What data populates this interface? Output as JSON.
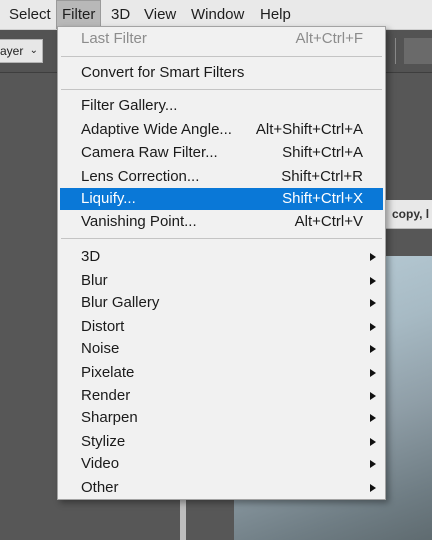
{
  "menubar": {
    "items": [
      "Select",
      "Filter",
      "3D",
      "View",
      "Window",
      "Help"
    ],
    "active": "Filter"
  },
  "options_bar": {
    "layer_select_value": "ayer"
  },
  "document": {
    "tab_title": "copy, l"
  },
  "filter_menu": {
    "last_filter": {
      "label": "Last Filter",
      "shortcut": "Alt+Ctrl+F",
      "enabled": false
    },
    "convert": {
      "label": "Convert for Smart Filters"
    },
    "filter_gallery": {
      "label": "Filter Gallery..."
    },
    "adaptive_wide_angle": {
      "label": "Adaptive Wide Angle...",
      "shortcut": "Alt+Shift+Ctrl+A"
    },
    "camera_raw": {
      "label": "Camera Raw Filter...",
      "shortcut": "Shift+Ctrl+A"
    },
    "lens_correction": {
      "label": "Lens Correction...",
      "shortcut": "Shift+Ctrl+R"
    },
    "liquify": {
      "label": "Liquify...",
      "shortcut": "Shift+Ctrl+X",
      "highlighted": true
    },
    "vanishing_point": {
      "label": "Vanishing Point...",
      "shortcut": "Alt+Ctrl+V"
    },
    "submenus": [
      "3D",
      "Blur",
      "Blur Gallery",
      "Distort",
      "Noise",
      "Pixelate",
      "Render",
      "Sharpen",
      "Stylize",
      "Video",
      "Other"
    ]
  },
  "colors": {
    "highlight": "#0a78d7",
    "menu_bg": "#f1f1f1",
    "menubar_bg": "#e9e9e9",
    "workspace": "#575757"
  }
}
